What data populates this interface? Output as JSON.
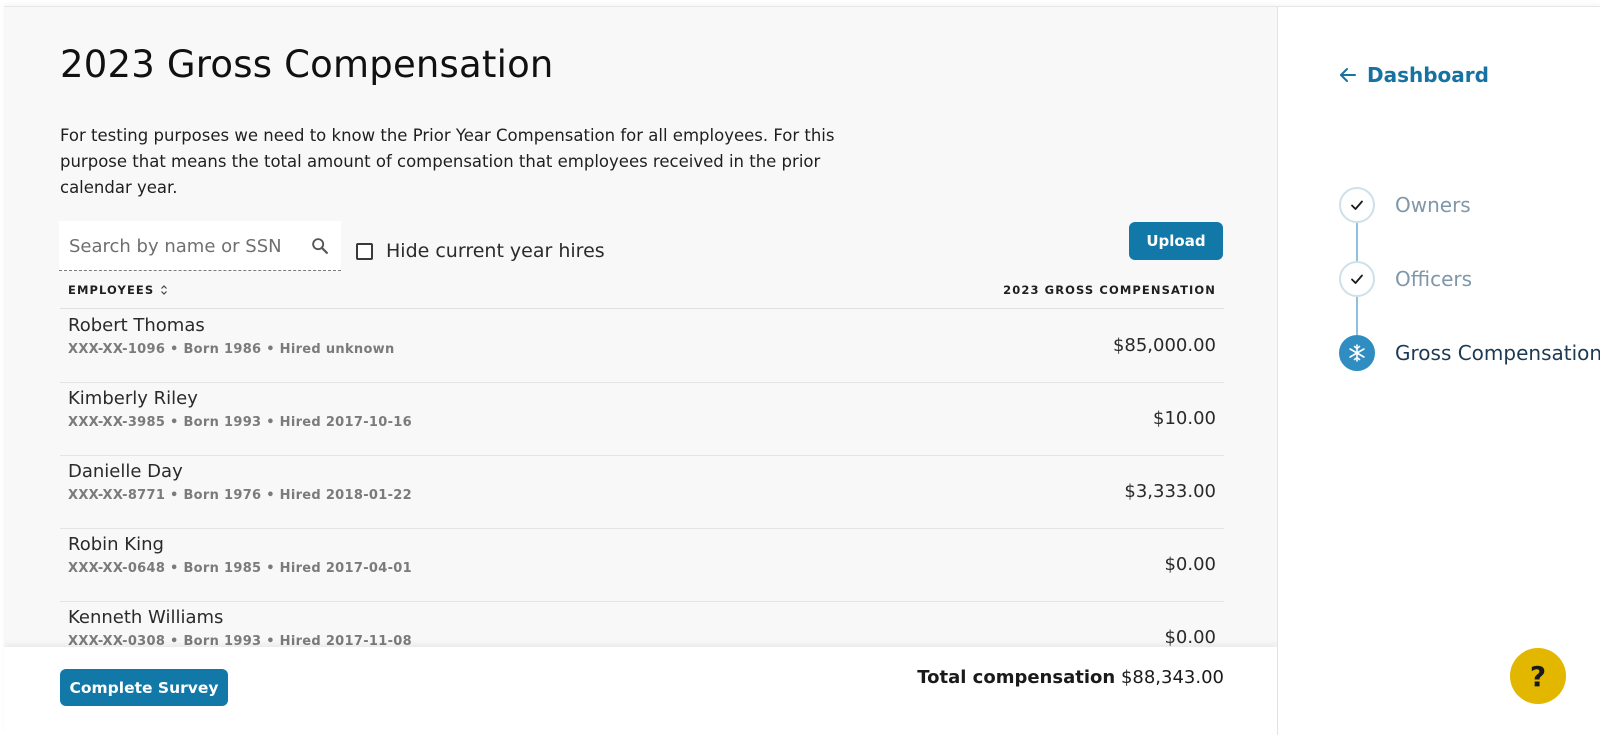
{
  "page": {
    "title": "2023 Gross Compensation",
    "intro": "For testing purposes we need to know the Prior Year Compensation for all employees. For this purpose that means the total amount of compensation that employees received in the prior calendar year."
  },
  "toolbar": {
    "search_placeholder": "Search by name or SSN",
    "search_icon": "search-icon",
    "hide_hires_label": "Hide current year hires",
    "hide_hires_checked": false,
    "upload_label": "Upload"
  },
  "table": {
    "col_employees": "EMPLOYEES",
    "col_compensation": "2023 GROSS COMPENSATION",
    "rows": [
      {
        "name": "Robert Thomas",
        "meta": "XXX-XX-1096 • Born 1986 • Hired unknown",
        "amount": "$85,000.00"
      },
      {
        "name": "Kimberly Riley",
        "meta": "XXX-XX-3985 • Born 1993 • Hired 2017-10-16",
        "amount": "$10.00"
      },
      {
        "name": "Danielle Day",
        "meta": "XXX-XX-8771 • Born 1976 • Hired 2018-01-22",
        "amount": "$3,333.00"
      },
      {
        "name": "Robin King",
        "meta": "XXX-XX-0648 • Born 1985 • Hired 2017-04-01",
        "amount": "$0.00"
      },
      {
        "name": "Kenneth Williams",
        "meta": "XXX-XX-0308 • Born 1993 • Hired 2017-11-08",
        "amount": "$0.00"
      }
    ]
  },
  "footer": {
    "complete_label": "Complete Survey",
    "total_label": "Total compensation",
    "total_value": "$88,343.00"
  },
  "sidebar": {
    "back_label": "Dashboard",
    "steps": [
      {
        "label": "Owners",
        "state": "done",
        "icon": "check-icon"
      },
      {
        "label": "Officers",
        "state": "done",
        "icon": "check-icon"
      },
      {
        "label": "Gross Compensation",
        "state": "active",
        "icon": "snowflake-icon"
      }
    ]
  },
  "help": {
    "label": "?"
  },
  "colors": {
    "accent": "#1178a8",
    "link": "#1672a0",
    "step_active": "#2f8dc2",
    "step_line": "#8ec0df",
    "help": "#e3b600"
  }
}
